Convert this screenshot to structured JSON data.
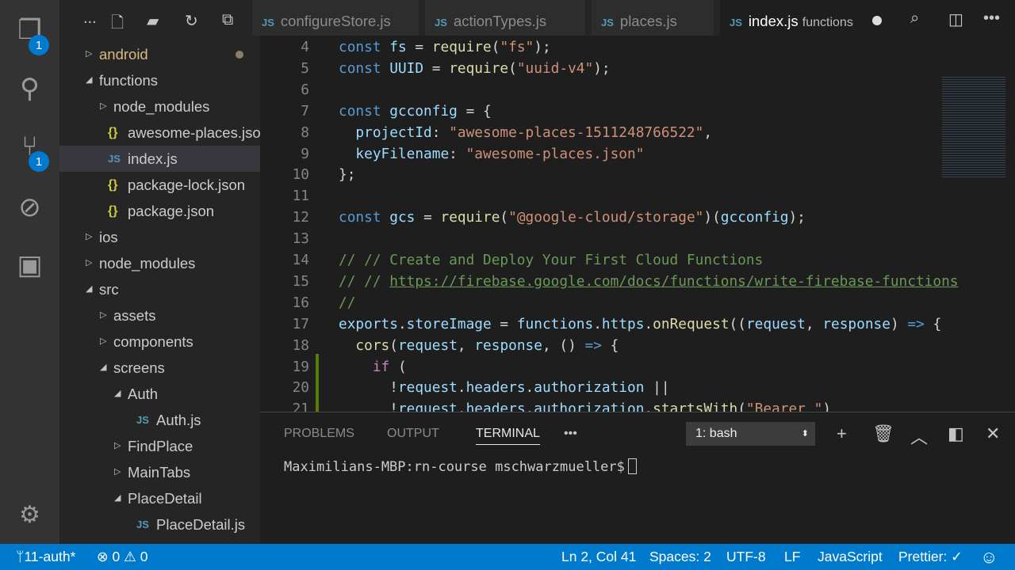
{
  "activity": {
    "explorer_badge": "1",
    "scm_badge": "1"
  },
  "sidebar": {
    "more": "...",
    "items": [
      {
        "label": "android",
        "type": "folder",
        "open": false,
        "depth": 0,
        "color": "#d7ba7d",
        "dot": true
      },
      {
        "label": "functions",
        "type": "folder",
        "open": true,
        "depth": 0
      },
      {
        "label": "node_modules",
        "type": "folder",
        "open": false,
        "depth": 1
      },
      {
        "label": "awesome-places.json",
        "type": "json",
        "depth": 1
      },
      {
        "label": "index.js",
        "type": "js",
        "depth": 1,
        "selected": true
      },
      {
        "label": "package-lock.json",
        "type": "json",
        "depth": 1
      },
      {
        "label": "package.json",
        "type": "json",
        "depth": 1
      },
      {
        "label": "ios",
        "type": "folder",
        "open": false,
        "depth": 0
      },
      {
        "label": "node_modules",
        "type": "folder",
        "open": false,
        "depth": 0
      },
      {
        "label": "src",
        "type": "folder",
        "open": true,
        "depth": 0
      },
      {
        "label": "assets",
        "type": "folder",
        "open": false,
        "depth": 1
      },
      {
        "label": "components",
        "type": "folder",
        "open": false,
        "depth": 1
      },
      {
        "label": "screens",
        "type": "folder",
        "open": true,
        "depth": 1
      },
      {
        "label": "Auth",
        "type": "folder",
        "open": true,
        "depth": 2
      },
      {
        "label": "Auth.js",
        "type": "js",
        "depth": 3
      },
      {
        "label": "FindPlace",
        "type": "folder",
        "open": false,
        "depth": 2
      },
      {
        "label": "MainTabs",
        "type": "folder",
        "open": false,
        "depth": 2
      },
      {
        "label": "PlaceDetail",
        "type": "folder",
        "open": true,
        "depth": 2
      },
      {
        "label": "PlaceDetail.js",
        "type": "js",
        "depth": 3
      }
    ]
  },
  "tabs": [
    {
      "label": "configureStore.js",
      "icon": "JS"
    },
    {
      "label": "actionTypes.js",
      "icon": "JS"
    },
    {
      "label": "places.js",
      "icon": "JS"
    },
    {
      "label": "index.js",
      "icon": "JS",
      "desc": "functions",
      "active": true,
      "dirty": true
    }
  ],
  "code": [
    {
      "n": "4",
      "t": [
        [
          "const ",
          "kw"
        ],
        [
          "fs",
          "vr"
        ],
        [
          " = ",
          "pn"
        ],
        [
          "require",
          "fn"
        ],
        [
          "(",
          "pn"
        ],
        [
          "\"fs\"",
          "st"
        ],
        [
          ");",
          "pn"
        ]
      ]
    },
    {
      "n": "5",
      "t": [
        [
          "const ",
          "kw"
        ],
        [
          "UUID",
          "vr"
        ],
        [
          " = ",
          "pn"
        ],
        [
          "require",
          "fn"
        ],
        [
          "(",
          "pn"
        ],
        [
          "\"uuid-v4\"",
          "st"
        ],
        [
          ");",
          "pn"
        ]
      ]
    },
    {
      "n": "6",
      "t": []
    },
    {
      "n": "7",
      "t": [
        [
          "const ",
          "kw"
        ],
        [
          "gcconfig",
          "vr"
        ],
        [
          " = {",
          "pn"
        ]
      ]
    },
    {
      "n": "8",
      "t": [
        [
          "  projectId",
          "vr"
        ],
        [
          ": ",
          "pn"
        ],
        [
          "\"awesome-places-1511248766522\"",
          "st"
        ],
        [
          ",",
          "pn"
        ]
      ]
    },
    {
      "n": "9",
      "t": [
        [
          "  keyFilename",
          "vr"
        ],
        [
          ": ",
          "pn"
        ],
        [
          "\"awesome-places.json\"",
          "st"
        ]
      ]
    },
    {
      "n": "10",
      "t": [
        [
          "};",
          "pn"
        ]
      ]
    },
    {
      "n": "11",
      "t": []
    },
    {
      "n": "12",
      "t": [
        [
          "const ",
          "kw"
        ],
        [
          "gcs",
          "vr"
        ],
        [
          " = ",
          "pn"
        ],
        [
          "require",
          "fn"
        ],
        [
          "(",
          "pn"
        ],
        [
          "\"@google-cloud/storage\"",
          "st"
        ],
        [
          ")(",
          "pn"
        ],
        [
          "gcconfig",
          "vr"
        ],
        [
          ");",
          "pn"
        ]
      ]
    },
    {
      "n": "13",
      "t": []
    },
    {
      "n": "14",
      "t": [
        [
          "// // Create and Deploy Your First Cloud Functions",
          "cm"
        ]
      ]
    },
    {
      "n": "15",
      "t": [
        [
          "// // ",
          "cm"
        ],
        [
          "https://firebase.google.com/docs/functions/write-firebase-functions",
          "lk"
        ]
      ]
    },
    {
      "n": "16",
      "t": [
        [
          "//",
          "cm"
        ]
      ]
    },
    {
      "n": "17",
      "t": [
        [
          "exports",
          "vr"
        ],
        [
          ".",
          "pn"
        ],
        [
          "storeImage",
          "vr"
        ],
        [
          " = ",
          "pn"
        ],
        [
          "functions",
          "vr"
        ],
        [
          ".",
          "pn"
        ],
        [
          "https",
          "vr"
        ],
        [
          ".",
          "pn"
        ],
        [
          "onRequest",
          "fn"
        ],
        [
          "((",
          "pn"
        ],
        [
          "request",
          "vr"
        ],
        [
          ", ",
          "pn"
        ],
        [
          "response",
          "vr"
        ],
        [
          ") ",
          "pn"
        ],
        [
          "=>",
          "kw"
        ],
        [
          " {",
          "pn"
        ]
      ]
    },
    {
      "n": "18",
      "t": [
        [
          "  ",
          "pn"
        ],
        [
          "cors",
          "fn"
        ],
        [
          "(",
          "pn"
        ],
        [
          "request",
          "vr"
        ],
        [
          ", ",
          "pn"
        ],
        [
          "response",
          "vr"
        ],
        [
          ", () ",
          "pn"
        ],
        [
          "=>",
          "kw"
        ],
        [
          " {",
          "pn"
        ]
      ]
    },
    {
      "n": "19",
      "t": [
        [
          "    ",
          "pn"
        ],
        [
          "if",
          "ctl"
        ],
        [
          " (",
          "pn"
        ]
      ]
    },
    {
      "n": "20",
      "t": [
        [
          "      !",
          "pn"
        ],
        [
          "request",
          "vr"
        ],
        [
          ".",
          "pn"
        ],
        [
          "headers",
          "vr"
        ],
        [
          ".",
          "pn"
        ],
        [
          "authorization",
          "vr"
        ],
        [
          " ||",
          "pn"
        ]
      ]
    },
    {
      "n": "21",
      "t": [
        [
          "      !",
          "pn"
        ],
        [
          "request",
          "vr"
        ],
        [
          ".",
          "pn"
        ],
        [
          "headers",
          "vr"
        ],
        [
          ".",
          "pn"
        ],
        [
          "authorization",
          "vr"
        ],
        [
          ".",
          "pn"
        ],
        [
          "startsWith",
          "fn"
        ],
        [
          "(",
          "pn"
        ],
        [
          "\"Bearer \"",
          "st"
        ],
        [
          ")",
          "pn"
        ]
      ]
    }
  ],
  "panel": {
    "tabs": [
      "PROBLEMS",
      "OUTPUT",
      "TERMINAL"
    ],
    "active": "TERMINAL",
    "more": "•••",
    "terminal_select": "1: bash",
    "prompt": "Maximilians-MBP:rn-course mschwarzmueller$"
  },
  "status": {
    "branch": "11-auth*",
    "errors": "0",
    "warnings": "0",
    "position": "Ln 2, Col 41",
    "spaces": "Spaces: 2",
    "encoding": "UTF-8",
    "eol": "LF",
    "language": "JavaScript",
    "prettier": "Prettier: ✓"
  }
}
